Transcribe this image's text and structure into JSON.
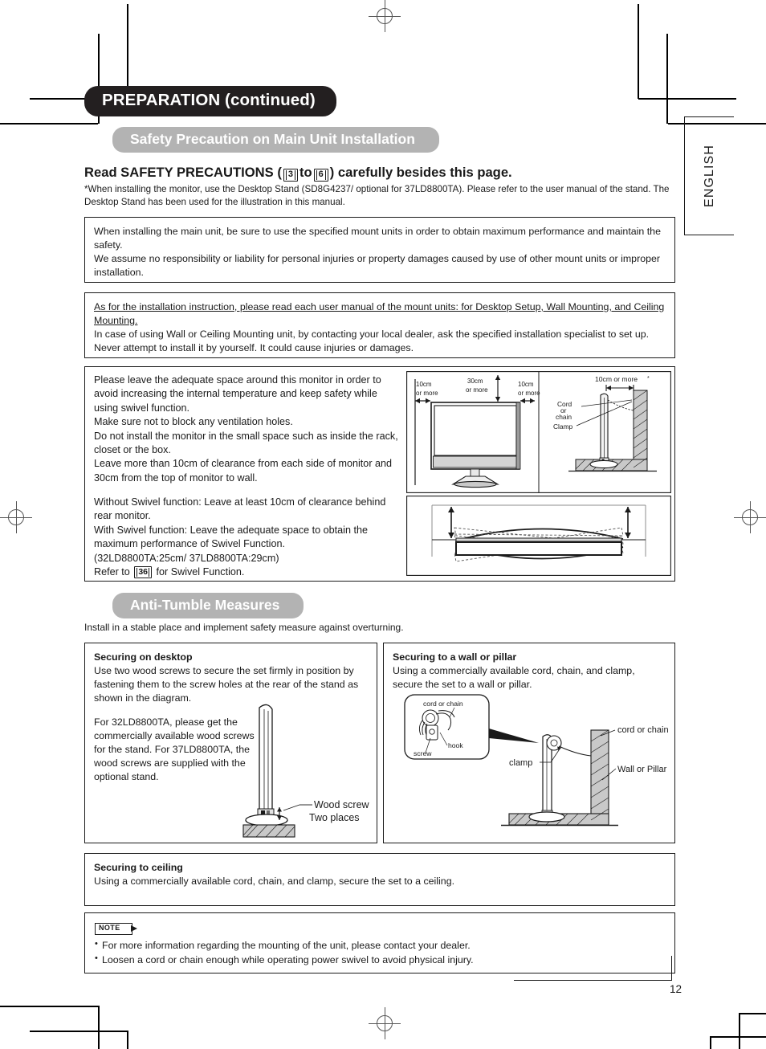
{
  "document": {
    "title": "PREPARATION (continued)",
    "page_number": "12",
    "language_tab": "ENGLISH"
  },
  "sections": {
    "safety": {
      "pill": "Safety Precaution on Main Unit Installation",
      "heading_pre": "Read SAFETY PRECAUTIONS (",
      "heading_ref_from": "3",
      "heading_mid": "to",
      "heading_ref_to": "6",
      "heading_post": ") carefully besides this page.",
      "subnote": "*When installing the monitor, use the Desktop Stand (SD8G4237/ optional for 37LD8800TA). Please refer to the user manual of the stand. The Desktop Stand has been used for the illustration in this manual."
    },
    "antitumble": {
      "pill": "Anti-Tumble Measures",
      "lead": "Install in a stable place and implement safety measure against overturning."
    }
  },
  "boxes": {
    "mount_units": {
      "line1": "When installing the main unit, be sure to use the specified mount units in order to obtain maximum performance and maintain the safety.",
      "line2": "We assume no responsibility or liability for personal injuries or property damages caused by use of other mount units or improper installation."
    },
    "installation_instruction": {
      "underlined": "As for the installation instruction, please read each user manual of the mount units: for Desktop Setup, Wall Mounting, and Ceiling Mounting.",
      "body": "In case of using Wall or Ceiling Mounting unit, by contacting your local dealer, ask the specified installation specialist to set up. Never attempt to install it by yourself. It could cause injuries or damages."
    },
    "spacing": {
      "para1": "Please leave the adequate space around this monitor in order to avoid increasing the internal temperature and keep safety while using swivel function.",
      "para2": "Make sure not to block any ventilation holes.",
      "para3": "Do not install the monitor in the small space such as inside the rack, closet or the box.",
      "para4": "Leave more than 10cm of clearance from each side of monitor and 30cm from the top of monitor to wall.",
      "para5": "Without Swivel function: Leave at least 10cm of clearance behind rear monitor.",
      "para6": "With Swivel function: Leave the adequate space to obtain the maximum performance of Swivel Function.",
      "para7": "(32LD8800TA:25cm/ 37LD8800TA:29cm)",
      "refer_pre": "Refer to",
      "refer_page": "36",
      "refer_post": "for Swivel Function."
    },
    "securing_desktop": {
      "heading": "Securing on desktop",
      "para1": "Use two wood screws to secure the set firmly in position by fastening them to the screw holes at the rear of the stand as shown in the diagram.",
      "para2": "For 32LD8800TA, please get the commercially available wood screws for the stand. For 37LD8800TA, the wood screws are supplied with the optional stand.",
      "callout_line1": "Wood screw",
      "callout_line2": "Two places"
    },
    "securing_wall": {
      "heading": "Securing to a wall or pillar",
      "para1": "Using a commercially available cord, chain, and clamp, secure the set to a wall or pillar.",
      "label_cord_inset": "cord or chain",
      "label_hook": "hook",
      "label_screw": "screw",
      "label_cord": "cord or chain",
      "label_clamp": "clamp",
      "label_wall": "Wall or Pillar"
    },
    "securing_ceiling": {
      "heading": "Securing to ceiling",
      "para1": "Using a commercially available cord, chain, and clamp, secure the set to a ceiling."
    },
    "note": {
      "tag": "NOTE",
      "items": [
        "For more information regarding the mounting of the unit, please contact your dealer.",
        "Loosen a cord or chain enough while operating power swivel to avoid physical injury."
      ]
    }
  },
  "figures": {
    "clearance_front": {
      "left": "10cm\nor more",
      "top": "30cm\nor more",
      "right": "10cm\nor more"
    },
    "clearance_side": {
      "top": "10cm or more",
      "cord": "Cord\nor\nchain",
      "clamp": "Clamp"
    }
  },
  "colors": {
    "title_pill_bg": "#231f20",
    "section_pill_bg": "#b3b3b3",
    "ink": "#1a1a1a",
    "fill_gray": "#c9c9c9",
    "fill_light": "#e6e6e6"
  }
}
